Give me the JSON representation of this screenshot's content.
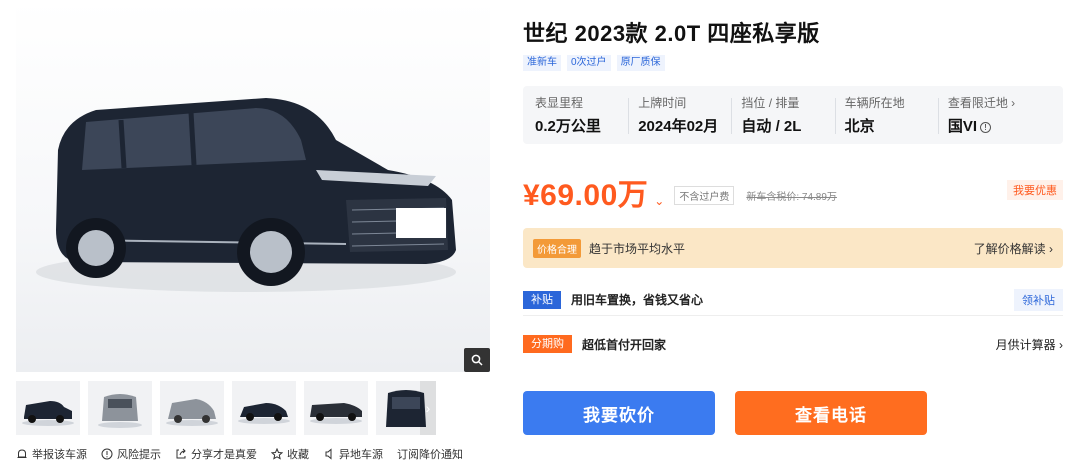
{
  "listing": {
    "title": "世纪 2023款 2.0T 四座私享版",
    "tags": [
      "准新车",
      "0次过户",
      "原厂质保"
    ]
  },
  "specs": [
    {
      "label": "表显里程",
      "value": "0.2万公里"
    },
    {
      "label": "上牌时间",
      "value": "2024年02月"
    },
    {
      "label": "挡位 / 排量",
      "value": "自动 / 2L"
    },
    {
      "label": "车辆所在地",
      "value": "北京"
    },
    {
      "label": "查看限迁地 ›",
      "value": "国VI",
      "info": "!"
    }
  ],
  "price": {
    "value": "¥69.00万",
    "arrow": "⌄",
    "tax_badge": "不含过户费",
    "new_price": "新车含税价: 74.89万",
    "discount": "我要优惠"
  },
  "banner": {
    "badge": "价格合理",
    "text": "趋于市场平均水平",
    "link": "了解价格解读 ›"
  },
  "subsidy": {
    "badge": "补贴",
    "text": "用旧车置换，省钱又省心",
    "link": "领补贴"
  },
  "installment": {
    "badge": "分期购",
    "text": "超低首付开回家",
    "link": "月供计算器 ›"
  },
  "buttons": {
    "bargain": "我要砍价",
    "phone": "查看电话"
  },
  "actions": [
    {
      "icon": "bell-icon",
      "label": "举报该车源"
    },
    {
      "icon": "warning-icon",
      "label": "风险提示"
    },
    {
      "icon": "share-icon",
      "label": "分享才是真爱"
    },
    {
      "icon": "star-icon",
      "label": "收藏"
    },
    {
      "icon": "location-icon",
      "label": "异地车源"
    },
    {
      "icon": "",
      "label": "订阅降价通知"
    }
  ],
  "colors": {
    "accent_orange": "#ff5a1f",
    "accent_blue": "#3b7bf0",
    "car_body": "#1d2533"
  }
}
